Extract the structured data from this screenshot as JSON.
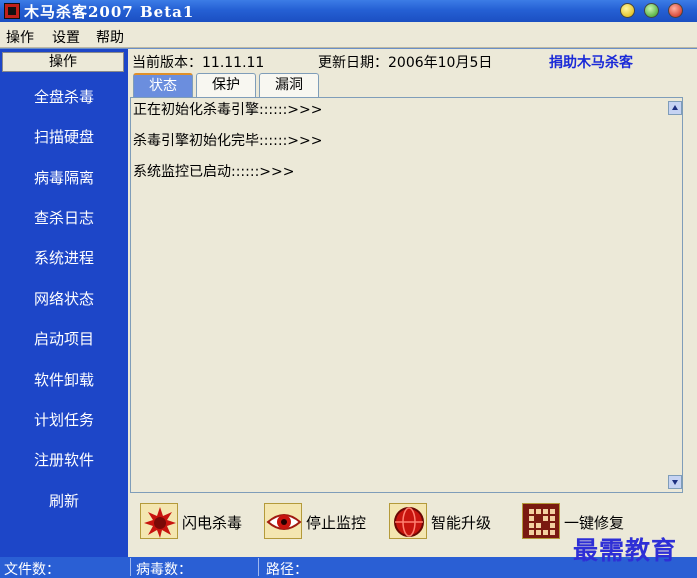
{
  "window": {
    "title": "木马杀客2007 Beta1"
  },
  "menu": {
    "items": [
      "操作",
      "设置",
      "帮助"
    ]
  },
  "sidebar": {
    "header": "操作",
    "items": [
      "全盘杀毒",
      "扫描硬盘",
      "病毒隔离",
      "查杀日志",
      "系统进程",
      "网络状态",
      "启动项目",
      "软件卸载",
      "计划任务",
      "注册软件",
      "刷新"
    ]
  },
  "info": {
    "version": "当前版本：11.11.11",
    "update_date": "更新日期：2006年10月5日",
    "donate_link": "捐助木马杀客"
  },
  "tabs": [
    "状态",
    "保护",
    "漏洞"
  ],
  "log": {
    "lines": [
      "正在初始化杀毒引擎::::::>>>",
      "杀毒引擎初始化完毕::::::>>>",
      "系统监控已启动::::::>>>"
    ]
  },
  "actions": [
    {
      "label": "闪电杀毒",
      "icon": "virus-splash-icon"
    },
    {
      "label": "停止监控",
      "icon": "eye-icon"
    },
    {
      "label": "智能升级",
      "icon": "red-globe-icon"
    },
    {
      "label": "一键修复",
      "icon": "grid-repair-icon"
    }
  ],
  "status": {
    "files": "文件数：",
    "viruses": "病毒数：",
    "path": "路径："
  },
  "watermark": "最需教育",
  "colors": {
    "sidebar_bg": "#1d46c8",
    "titlebar_bg": "#2560d4",
    "panel_bg": "#ece9d8",
    "donate_link": "#1a2ad8"
  }
}
